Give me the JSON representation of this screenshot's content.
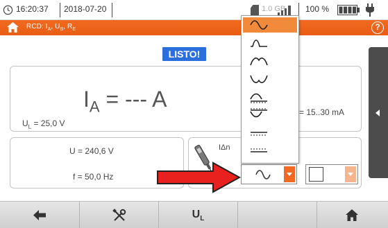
{
  "status": {
    "time": "16:20:37",
    "date": "2018-07-20",
    "storage": "1.0 GB",
    "battery": "100 %"
  },
  "title": {
    "text": "RCD: IA, UB, RE",
    "text_main": "RCD: I",
    "sub_a": "A",
    "sep1": ", U",
    "sub_b": "B",
    "sep2": ", R",
    "sub_e": "E"
  },
  "status_badge": "LISTO!",
  "result": {
    "prefix": "I",
    "subscript": "A",
    "value": "= --- A"
  },
  "ul": {
    "prefix": "U",
    "sub": "L",
    "value": " = 25,0 V"
  },
  "range": "= 15..30 mA",
  "voltage": "U = 240,6 V",
  "frequency": "f = 50,0 Hz",
  "idn_label": "IΔn",
  "waveform_options": [
    {
      "name": "sine",
      "selected": true
    },
    {
      "name": "positive-half-wave",
      "selected": false
    },
    {
      "name": "negative-half-wave",
      "selected": false
    },
    {
      "name": "positive-half-wave-alt",
      "selected": false
    },
    {
      "name": "positive-half-wave-dc",
      "selected": false
    },
    {
      "name": "negative-half-wave-dc",
      "selected": false
    },
    {
      "name": "dc-positive",
      "selected": false
    },
    {
      "name": "dc-negative",
      "selected": false
    }
  ],
  "selected_waveform": "sine",
  "toolbar": {
    "ul_label": "UL",
    "ul_main": "U",
    "ul_sub": "L"
  },
  "colors": {
    "accent": "#f26a21",
    "badge": "#2a6fdc",
    "arrow": "#e8201e"
  }
}
